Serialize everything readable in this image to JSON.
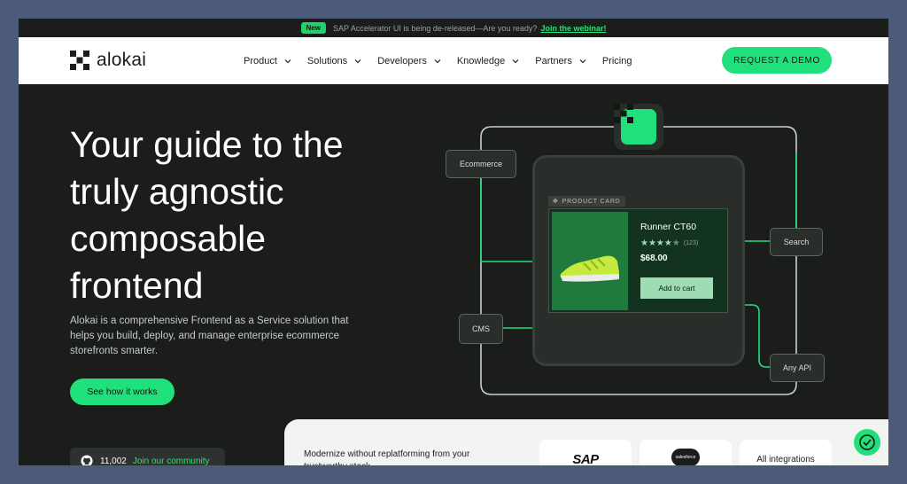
{
  "announcement": {
    "badge": "New",
    "text": "SAP Accelerator UI is being de-released—Are you ready?",
    "link": "Join the webinar!"
  },
  "nav": {
    "logo_text": "alokai",
    "menu": [
      {
        "label": "Product",
        "has_dropdown": true
      },
      {
        "label": "Solutions",
        "has_dropdown": true
      },
      {
        "label": "Developers",
        "has_dropdown": true
      },
      {
        "label": "Knowledge",
        "has_dropdown": true
      },
      {
        "label": "Partners",
        "has_dropdown": true
      },
      {
        "label": "Pricing",
        "has_dropdown": false
      }
    ],
    "cta": "REQUEST A DEMO"
  },
  "hero": {
    "title": "Your guide to the truly agnostic composable frontend",
    "description": "Alokai is a comprehensive Frontend as a Service solution that helps you build, deploy, and manage enterprise ecommerce storefronts smarter.",
    "button": "See how it works"
  },
  "community": {
    "count": "11,002",
    "link": "Join our community"
  },
  "diagram": {
    "nodes": {
      "ecommerce": "Ecommerce",
      "search": "Search",
      "cms": "CMS",
      "any_api": "Any API"
    },
    "product_card": {
      "label": "PRODUCT CARD",
      "name": "Runner CT60",
      "rating": 4.5,
      "review_count": "(123)",
      "price": "$68.00",
      "button": "Add to cart"
    }
  },
  "bottom": {
    "text": "Modernize without replatforming from your trustworthy stack",
    "logos": [
      "SAP",
      "salesforce"
    ],
    "all_integrations": "All integrations"
  },
  "colors": {
    "accent": "#1fe07a",
    "background": "#1b1d1b",
    "outer": "#4a5a78"
  }
}
